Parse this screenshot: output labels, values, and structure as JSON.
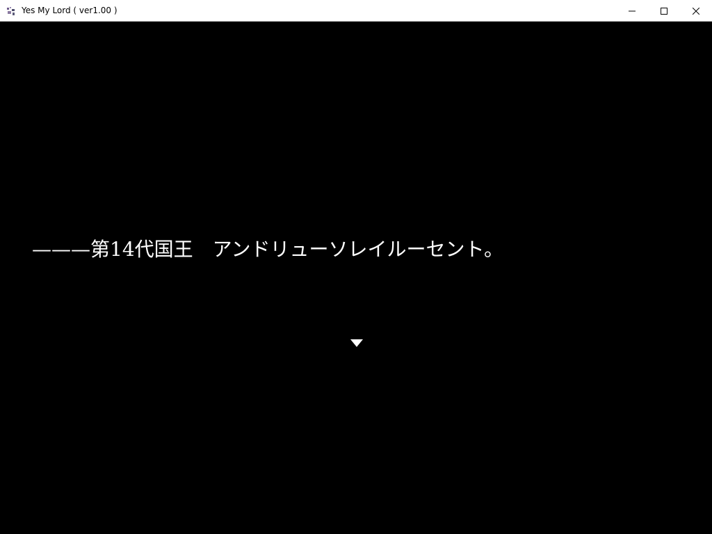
{
  "window": {
    "title": "Yes My Lord ( ver1.00 )",
    "icon": "app-icon"
  },
  "controls": {
    "minimize_icon": "minimize-icon",
    "maximize_icon": "maximize-icon",
    "close_icon": "close-icon"
  },
  "game": {
    "background_color": "#000000",
    "text_color": "#ffffff",
    "dialogue_text": "———第14代国王　アンドリューソレイルーセント。",
    "advance_indicator_icon": "triangle-down-icon"
  }
}
